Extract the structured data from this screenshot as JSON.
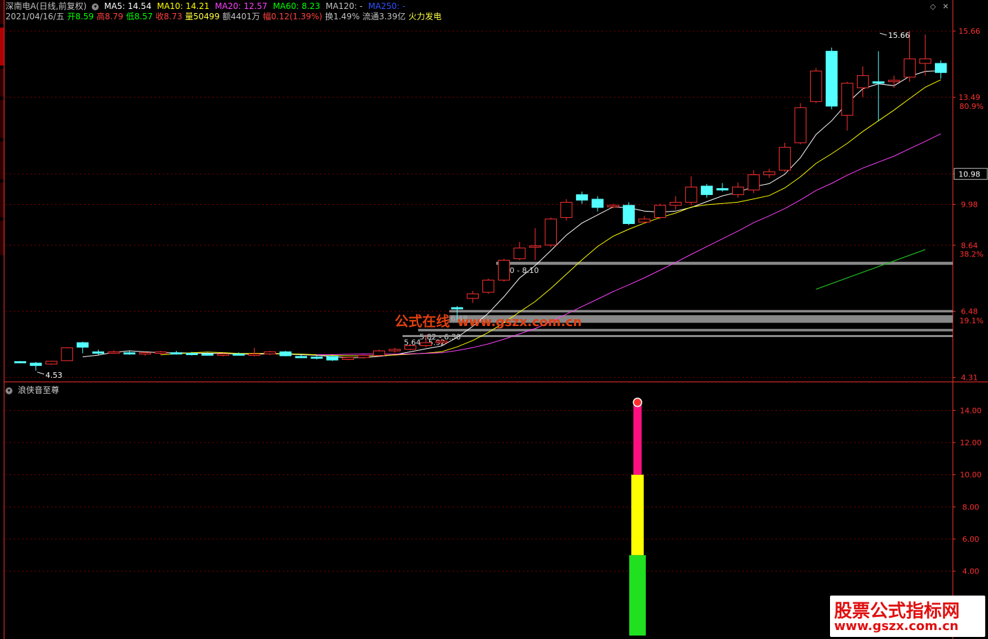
{
  "header": {
    "stock_name": "深南电A(日线,前复权)",
    "ma_items": [
      {
        "label": "MA5: 14.54",
        "color": "#ffffff"
      },
      {
        "label": "MA10: 14.21",
        "color": "#ffff00"
      },
      {
        "label": "MA20: 12.57",
        "color": "#ff40ff"
      },
      {
        "label": "MA60: 8.23",
        "color": "#00ff00"
      },
      {
        "label": "MA120: -",
        "color": "#c0c0c0"
      },
      {
        "label": "MA250: -",
        "color": "#3050ff"
      }
    ],
    "quote_items": [
      {
        "label": "2021/04/16/五",
        "color": "#c0c0c0"
      },
      {
        "label": "开8.59",
        "color": "#00ff00"
      },
      {
        "label": "高8.79",
        "color": "#ff4040"
      },
      {
        "label": "低8.57",
        "color": "#00ff00"
      },
      {
        "label": "收8.73",
        "color": "#ff4040"
      },
      {
        "label": "量50499",
        "color": "#ffff40"
      },
      {
        "label": "额4401万",
        "color": "#c0c0c0"
      },
      {
        "label": "幅0.12(1.39%)",
        "color": "#ff4040"
      },
      {
        "label": "换1.49%",
        "color": "#c0c0c0"
      },
      {
        "label": "流通3.39亿",
        "color": "#c0c0c0"
      },
      {
        "label": "火力发电",
        "color": "#ffff40"
      }
    ]
  },
  "indicator_panel": {
    "title": "浪侠音至尊"
  },
  "watermark": {
    "text": "公式在线",
    "url": "www.gszx.com.cn"
  },
  "brand": {
    "line1": "股票公式指标网",
    "line2": "www.gszx.com.cn"
  },
  "colors": {
    "up": "#ff3030",
    "down": "#54ffff",
    "grid": "#800000",
    "axis": "#ff3030"
  },
  "chart_data": [
    {
      "type": "candlestick",
      "name": "main-price-chart",
      "ylim": [
        4.3,
        16.0
      ],
      "y_tick_labels": [
        "15.66",
        "13.49",
        "10.98",
        "9.98",
        "8.64",
        "6.48",
        "4.31"
      ],
      "percent_labels": [
        {
          "label": "80.9%",
          "price": 13.2
        },
        {
          "label": "38.2%",
          "price": 8.35
        },
        {
          "label": "19.1%",
          "price": 6.18
        }
      ],
      "current_price_label": "10.98",
      "current_price": 10.98,
      "max_marker": {
        "label": "15.66",
        "value": 15.66,
        "index": 55
      },
      "min_marker": {
        "label": "4.53",
        "value": 4.53,
        "index": 1
      },
      "zones": [
        {
          "label": "8.00 - 8.10",
          "low": 8.0,
          "high": 8.1,
          "start_index": 31
        },
        {
          "label": "6.48",
          "low": 6.44,
          "high": 6.52,
          "start_index": 28
        },
        {
          "label": "",
          "low": 6.1,
          "high": 6.35,
          "start_index": 28
        },
        {
          "label": "5.82 - 6.30",
          "low": 5.82,
          "high": 5.9,
          "start_index": 26
        },
        {
          "label": "5.64 - 5.92",
          "low": 5.64,
          "high": 5.7,
          "start_index": 25
        }
      ],
      "trend_line": {
        "color": "#20c020",
        "from": {
          "index": 51,
          "value": 7.2
        },
        "to": {
          "index": 58,
          "value": 8.5
        }
      },
      "candles": [
        {
          "o": 4.83,
          "h": 4.85,
          "l": 4.78,
          "c": 4.8
        },
        {
          "o": 4.78,
          "h": 4.82,
          "l": 4.53,
          "c": 4.7
        },
        {
          "o": 4.75,
          "h": 4.85,
          "l": 4.72,
          "c": 4.84
        },
        {
          "o": 4.86,
          "h": 5.3,
          "l": 4.85,
          "c": 5.28
        },
        {
          "o": 5.45,
          "h": 5.48,
          "l": 5.1,
          "c": 5.3
        },
        {
          "o": 5.15,
          "h": 5.22,
          "l": 5.05,
          "c": 5.1
        },
        {
          "o": 5.15,
          "h": 5.2,
          "l": 5.08,
          "c": 5.15
        },
        {
          "o": 5.12,
          "h": 5.18,
          "l": 5.05,
          "c": 5.08
        },
        {
          "o": 5.08,
          "h": 5.15,
          "l": 5.02,
          "c": 5.12
        },
        {
          "o": 5.1,
          "h": 5.18,
          "l": 5.05,
          "c": 5.15
        },
        {
          "o": 5.12,
          "h": 5.18,
          "l": 5.06,
          "c": 5.1
        },
        {
          "o": 5.1,
          "h": 5.15,
          "l": 5.03,
          "c": 5.08
        },
        {
          "o": 5.08,
          "h": 5.12,
          "l": 5.02,
          "c": 5.06
        },
        {
          "o": 5.06,
          "h": 5.1,
          "l": 5.0,
          "c": 5.08
        },
        {
          "o": 5.08,
          "h": 5.13,
          "l": 5.03,
          "c": 5.05
        },
        {
          "o": 5.05,
          "h": 5.28,
          "l": 5.0,
          "c": 5.08
        },
        {
          "o": 5.08,
          "h": 5.18,
          "l": 5.04,
          "c": 5.15
        },
        {
          "o": 5.15,
          "h": 5.18,
          "l": 5.0,
          "c": 5.02
        },
        {
          "o": 5.0,
          "h": 5.05,
          "l": 4.95,
          "c": 4.98
        },
        {
          "o": 4.98,
          "h": 5.02,
          "l": 4.9,
          "c": 4.95
        },
        {
          "o": 5.0,
          "h": 5.02,
          "l": 4.85,
          "c": 4.88
        },
        {
          "o": 4.9,
          "h": 4.98,
          "l": 4.88,
          "c": 4.96
        },
        {
          "o": 4.96,
          "h": 5.05,
          "l": 4.93,
          "c": 5.03
        },
        {
          "o": 5.03,
          "h": 5.22,
          "l": 5.0,
          "c": 5.18
        },
        {
          "o": 5.18,
          "h": 5.28,
          "l": 5.12,
          "c": 5.23
        },
        {
          "o": 5.23,
          "h": 5.38,
          "l": 5.2,
          "c": 5.35
        },
        {
          "o": 5.35,
          "h": 5.72,
          "l": 5.3,
          "c": 5.45
        },
        {
          "o": 5.45,
          "h": 5.58,
          "l": 5.4,
          "c": 5.5
        },
        {
          "o": 6.6,
          "h": 6.65,
          "l": 6.2,
          "c": 6.58
        },
        {
          "o": 6.9,
          "h": 7.15,
          "l": 6.75,
          "c": 7.05
        },
        {
          "o": 7.1,
          "h": 7.55,
          "l": 7.05,
          "c": 7.5
        },
        {
          "o": 7.5,
          "h": 8.2,
          "l": 7.45,
          "c": 8.15
        },
        {
          "o": 8.2,
          "h": 8.75,
          "l": 8.15,
          "c": 8.55
        },
        {
          "o": 8.6,
          "h": 9.2,
          "l": 8.15,
          "c": 8.62
        },
        {
          "o": 8.65,
          "h": 9.55,
          "l": 8.58,
          "c": 9.5
        },
        {
          "o": 9.55,
          "h": 10.15,
          "l": 9.45,
          "c": 10.05
        },
        {
          "o": 10.3,
          "h": 10.4,
          "l": 10.0,
          "c": 10.12
        },
        {
          "o": 10.15,
          "h": 10.25,
          "l": 9.75,
          "c": 9.88
        },
        {
          "o": 9.9,
          "h": 10.0,
          "l": 9.85,
          "c": 9.95
        },
        {
          "o": 9.95,
          "h": 10.05,
          "l": 9.3,
          "c": 9.35
        },
        {
          "o": 9.4,
          "h": 9.6,
          "l": 9.35,
          "c": 9.5
        },
        {
          "o": 9.55,
          "h": 10.0,
          "l": 9.5,
          "c": 9.95
        },
        {
          "o": 9.95,
          "h": 10.25,
          "l": 9.8,
          "c": 10.05
        },
        {
          "o": 10.05,
          "h": 10.9,
          "l": 9.95,
          "c": 10.55
        },
        {
          "o": 10.58,
          "h": 10.65,
          "l": 10.2,
          "c": 10.3
        },
        {
          "o": 10.5,
          "h": 10.68,
          "l": 10.4,
          "c": 10.45
        },
        {
          "o": 10.3,
          "h": 10.7,
          "l": 10.2,
          "c": 10.55
        },
        {
          "o": 10.45,
          "h": 11.1,
          "l": 10.35,
          "c": 10.95
        },
        {
          "o": 10.95,
          "h": 11.15,
          "l": 10.85,
          "c": 11.05
        },
        {
          "o": 11.1,
          "h": 12.0,
          "l": 11.05,
          "c": 11.85
        },
        {
          "o": 12.0,
          "h": 13.3,
          "l": 11.95,
          "c": 13.15
        },
        {
          "o": 13.35,
          "h": 14.45,
          "l": 13.3,
          "c": 14.35
        },
        {
          "o": 15.0,
          "h": 15.12,
          "l": 13.1,
          "c": 13.2
        },
        {
          "o": 12.9,
          "h": 14.0,
          "l": 12.4,
          "c": 13.95
        },
        {
          "o": 13.8,
          "h": 14.5,
          "l": 13.5,
          "c": 14.2
        },
        {
          "o": 14.0,
          "h": 15.0,
          "l": 12.7,
          "c": 13.95
        },
        {
          "o": 14.0,
          "h": 14.2,
          "l": 13.8,
          "c": 14.05
        },
        {
          "o": 14.15,
          "h": 15.66,
          "l": 14.0,
          "c": 14.75
        },
        {
          "o": 14.6,
          "h": 15.55,
          "l": 14.2,
          "c": 14.75
        },
        {
          "o": 14.6,
          "h": 14.7,
          "l": 14.1,
          "c": 14.3
        }
      ]
    },
    {
      "type": "bar",
      "name": "indicator-stacked-bar",
      "ylim": [
        0,
        15.0
      ],
      "y_tick_labels": [
        "14.00",
        "12.00",
        "10.00",
        "8.00",
        "6.00",
        "4.00"
      ],
      "segments": [
        {
          "from": 0,
          "to": 5.0,
          "color": "#20e020"
        },
        {
          "from": 5.0,
          "to": 10.0,
          "color": "#ffff00"
        },
        {
          "from": 10.0,
          "to": 14.5,
          "color": "#ff1080"
        }
      ],
      "top_marker_value": 14.5
    }
  ]
}
